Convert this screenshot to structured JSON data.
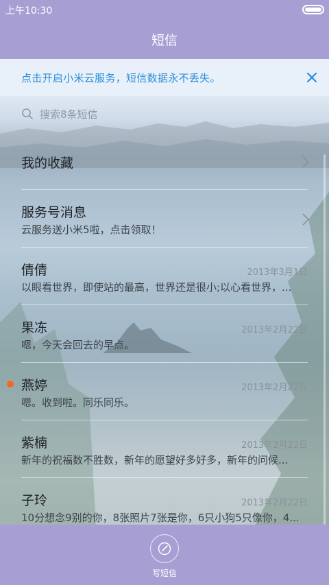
{
  "status_bar": {
    "time": "上午10:30"
  },
  "header": {
    "title": "短信"
  },
  "banner": {
    "text": "点击开启小米云服务，短信数据永不丢失。"
  },
  "search": {
    "placeholder": "搜索8条短信"
  },
  "list": [
    {
      "name": "我的收藏",
      "preview": "",
      "date": ""
    },
    {
      "name": "服务号消息",
      "preview": "云服务送小米5啦，点击领取！",
      "date": ""
    },
    {
      "name": "倩倩",
      "preview": "以眼看世界，即使站的最高，世界还是很小;以心看世界，...",
      "date": "2013年3月1日"
    },
    {
      "name": "果冻",
      "preview": "嗯，今天会回去的早点。",
      "date": "2013年2月22日"
    },
    {
      "name": "燕婷",
      "preview": "嗯。收到啦。同乐同乐。",
      "date": "2013年2月22日",
      "unread": true
    },
    {
      "name": "紫楠",
      "preview": "新年的祝福数不胜数，新年的愿望好多好多，新年的问候...",
      "date": "2013年2月22日"
    },
    {
      "name": "子玲",
      "preview": "10分想念9别的你，8张照片7张是你，6只小狗5只像你，4...",
      "date": "2013年2月22日"
    }
  ],
  "bottom_bar": {
    "compose_label": "写短信"
  },
  "colors": {
    "bar": "#a79fd3",
    "banner_text": "#2b8dd8",
    "unread": "#f26a1b"
  }
}
